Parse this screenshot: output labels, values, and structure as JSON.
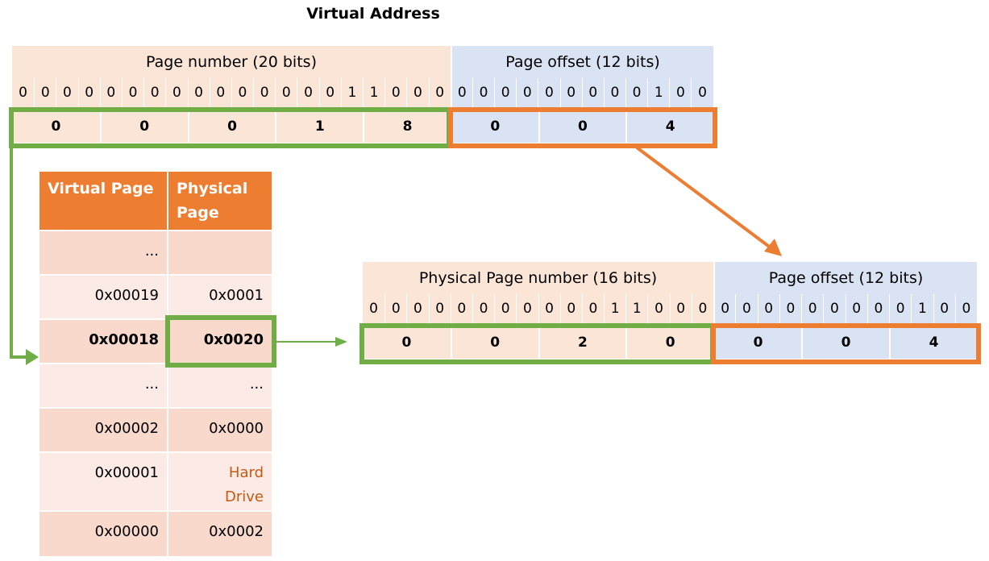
{
  "title": "Virtual Address",
  "virtual_address": {
    "page_number_label": "Page number (20 bits)",
    "page_offset_label": "Page offset (12 bits)",
    "page_number_bits": [
      "0",
      "0",
      "0",
      "0",
      "0",
      "0",
      "0",
      "0",
      "0",
      "0",
      "0",
      "0",
      "0",
      "0",
      "0",
      "1",
      "1",
      "0",
      "0",
      "0"
    ],
    "page_offset_bits": [
      "0",
      "0",
      "0",
      "0",
      "0",
      "0",
      "0",
      "0",
      "0",
      "1",
      "0",
      "0"
    ],
    "page_number_hex": [
      "0",
      "0",
      "0",
      "1",
      "8"
    ],
    "page_offset_hex": [
      "0",
      "0",
      "4"
    ]
  },
  "page_table": {
    "headers": [
      "Virtual Page",
      "Physical Page"
    ],
    "rows": [
      {
        "virtual": "...",
        "physical": ""
      },
      {
        "virtual": "0x00019",
        "physical": "0x0001"
      },
      {
        "virtual": "0x00018",
        "physical": "0x0020",
        "highlight": true
      },
      {
        "virtual": "...",
        "physical": "..."
      },
      {
        "virtual": "0x00002",
        "physical": "0x0000"
      },
      {
        "virtual": "0x00001",
        "physical": "Hard Drive",
        "disk": true
      },
      {
        "virtual": "0x00000",
        "physical": "0x0002"
      }
    ]
  },
  "physical_address": {
    "page_number_label": "Physical Page number (16 bits)",
    "page_offset_label": "Page offset (12 bits)",
    "page_number_bits": [
      "0",
      "0",
      "0",
      "0",
      "0",
      "0",
      "0",
      "0",
      "0",
      "0",
      "0",
      "1",
      "1",
      "0",
      "0",
      "0"
    ],
    "page_offset_bits": [
      "0",
      "0",
      "0",
      "0",
      "0",
      "0",
      "0",
      "0",
      "0",
      "1",
      "0",
      "0"
    ],
    "page_number_hex": [
      "0",
      "0",
      "2",
      "0"
    ],
    "page_offset_hex": [
      "0",
      "0",
      "4"
    ]
  },
  "colors": {
    "page_number_bg": "#fbe5d6",
    "page_offset_bg": "#dae3f3",
    "header_orange": "#ed7d31",
    "highlight_green": "#70ad47",
    "hard_drive_text": "#c55a11"
  }
}
